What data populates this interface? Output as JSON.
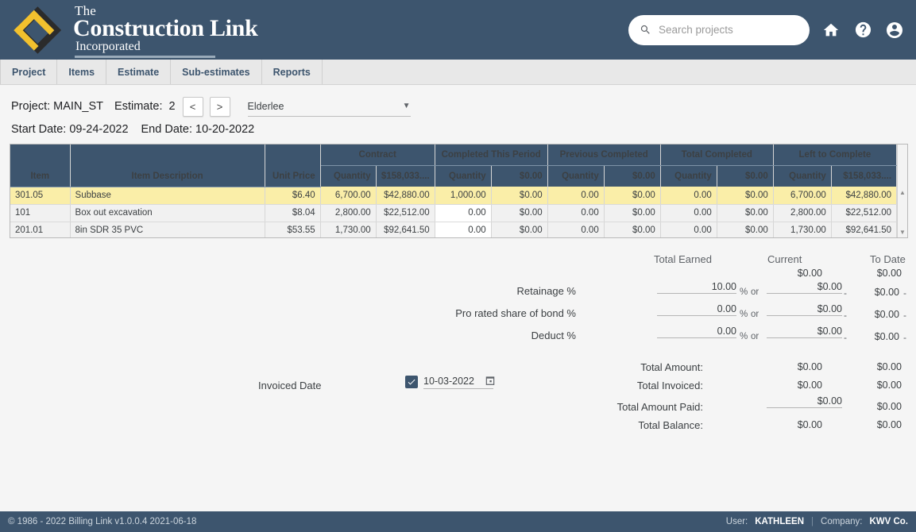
{
  "brand": {
    "the": "The",
    "name": "Construction Link",
    "incorporated": "Incorporated",
    "logo_icon": "construction-link-logo"
  },
  "search": {
    "placeholder": "Search projects",
    "value": "",
    "icon": "search-icon"
  },
  "header_icons": {
    "home": "home-icon",
    "help": "help-circle-icon",
    "account": "account-circle-icon"
  },
  "nav": {
    "items": [
      {
        "label": "Project"
      },
      {
        "label": "Items"
      },
      {
        "label": "Estimate"
      },
      {
        "label": "Sub-estimates"
      },
      {
        "label": "Reports"
      }
    ]
  },
  "project_bar": {
    "project_label": "Project: MAIN_ST",
    "estimate_label": "Estimate:",
    "estimate_number": "2",
    "prev_arrow": "<",
    "next_arrow": ">",
    "customer_select": "Elderlee",
    "caret_icon": "chevron-down-icon",
    "start_date": "Start Date: 09-24-2022",
    "end_date": "End Date: 10-20-2022"
  },
  "table": {
    "group_headers": [
      {
        "label": "Contract"
      },
      {
        "label": "Completed This Period"
      },
      {
        "label": "Previous Completed"
      },
      {
        "label": "Total Completed"
      },
      {
        "label": "Left to Complete"
      }
    ],
    "columns": {
      "item": "Item",
      "description": "Item Description",
      "unit_price": "Unit Price",
      "quantity": "Quantity",
      "contract_total": "$158,033....",
      "completed_this_period_total": "$0.00",
      "previous_completed_total": "$0.00",
      "total_completed_total": "$0.00",
      "left_to_complete_total": "$158,033...."
    },
    "rows": [
      {
        "item": "301.05",
        "description": "Subbase",
        "unit_price": "$6.40",
        "c_qty": "6,700.00",
        "c_amt": "$42,880.00",
        "ctp_qty": "1,000.00",
        "ctp_amt": "$0.00",
        "pc_qty": "0.00",
        "pc_amt": "$0.00",
        "tc_qty": "0.00",
        "tc_amt": "$0.00",
        "ltc_qty": "6,700.00",
        "ltc_amt": "$42,880.00"
      },
      {
        "item": "101",
        "description": "Box out excavation",
        "unit_price": "$8.04",
        "c_qty": "2,800.00",
        "c_amt": "$22,512.00",
        "ctp_qty": "0.00",
        "ctp_amt": "$0.00",
        "pc_qty": "0.00",
        "pc_amt": "$0.00",
        "tc_qty": "0.00",
        "tc_amt": "$0.00",
        "ltc_qty": "2,800.00",
        "ltc_amt": "$22,512.00"
      },
      {
        "item": "201.01",
        "description": "8in SDR 35 PVC",
        "unit_price": "$53.55",
        "c_qty": "1,730.00",
        "c_amt": "$92,641.50",
        "ctp_qty": "0.00",
        "ctp_amt": "$0.00",
        "pc_qty": "0.00",
        "pc_amt": "$0.00",
        "tc_qty": "0.00",
        "tc_amt": "$0.00",
        "ltc_qty": "1,730.00",
        "ltc_amt": "$92,641.50"
      }
    ],
    "scroll_up_icon": "scroll-up-arrow",
    "scroll_down_icon": "scroll-down-arrow"
  },
  "form": {
    "col_total_earned": "Total Earned",
    "col_current": "Current",
    "col_to_date": "To Date",
    "earned_current": "$0.00",
    "earned_to_date": "$0.00",
    "retainage_label": "Retainage %",
    "retainage_pct": "10.00",
    "retainage_current": "$0.00",
    "retainage_to_date": "$0.00",
    "bond_label": "Pro rated share of bond %",
    "bond_pct": "0.00",
    "bond_current": "$0.00",
    "bond_to_date": "$0.00",
    "deduct_label": "Deduct %",
    "deduct_pct": "0.00",
    "deduct_current": "$0.00",
    "deduct_to_date": "$0.00",
    "pct_symbol": "%",
    "or_text": "or",
    "minus": "-",
    "total_amount_label": "Total Amount:",
    "total_amount_current": "$0.00",
    "total_amount_to_date": "$0.00",
    "total_invoiced_label": "Total Invoiced:",
    "total_invoiced_current": "$0.00",
    "total_invoiced_to_date": "$0.00",
    "total_paid_label": "Total Amount Paid:",
    "total_paid_current": "$0.00",
    "total_paid_to_date": "$0.00",
    "total_balance_label": "Total Balance:",
    "total_balance_current": "$0.00",
    "total_balance_to_date": "$0.00",
    "invoiced_date_label": "Invoiced Date",
    "invoiced_date_value": "10-03-2022",
    "invoiced_date_checked": true,
    "calendar_icon": "calendar-icon",
    "checkbox_icon": "checkmark-icon"
  },
  "footer": {
    "copyright": "© 1986 - 2022 Billing Link v1.0.0.4 2021-06-18",
    "user_label": "User:",
    "user_name": "KATHLEEN",
    "company_label": "Company:",
    "company_name": "KWV Co."
  },
  "colors": {
    "brand_navy": "#3d556e",
    "row_selected": "#faeea8",
    "nav_bg": "#e8e8e8"
  }
}
